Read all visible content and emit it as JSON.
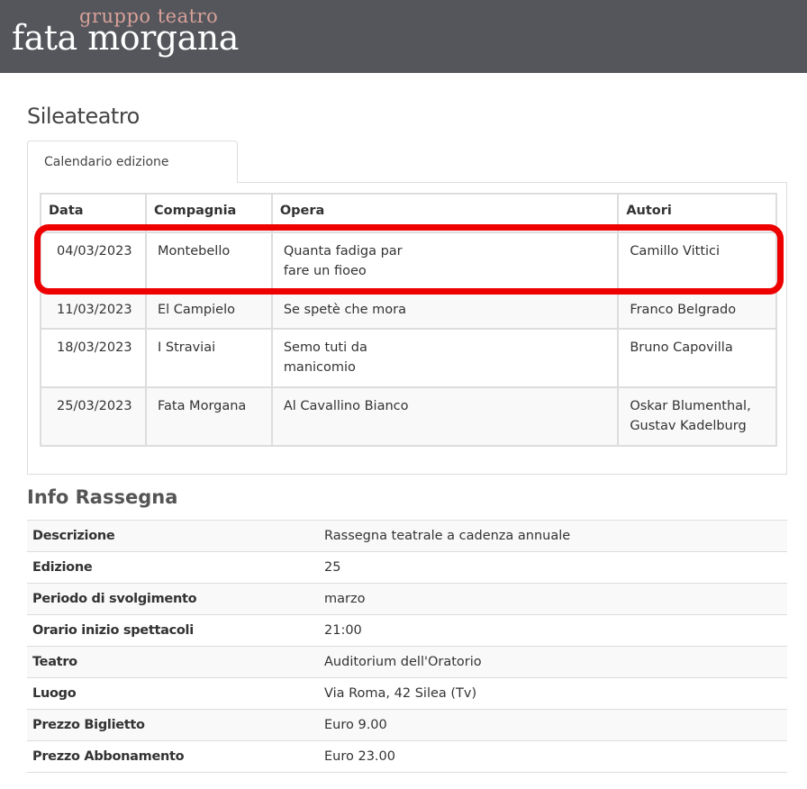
{
  "header": {
    "logo_top": "gruppo teatro",
    "logo_bottom": "fata morgana",
    "background_color": "#54565c",
    "logo_top_color": "#d8a199"
  },
  "page": {
    "title": "Sileateatro"
  },
  "tabs": [
    {
      "label": "Calendario edizione",
      "active": true
    }
  ],
  "calendar": {
    "columns": [
      "Data",
      "Compagnia",
      "Opera",
      "Autori"
    ],
    "rows": [
      {
        "data": "04/03/2023",
        "compagnia": "Montebello",
        "opera_l1": "Quanta fadiga par",
        "opera_l2": "fare un fioeo",
        "autori_l1": "Camillo Vittici",
        "autori_l2": ""
      },
      {
        "data": "11/03/2023",
        "compagnia": "El Campielo",
        "opera_l1": "Se spetè che mora",
        "opera_l2": "",
        "autori_l1": "Franco Belgrado",
        "autori_l2": ""
      },
      {
        "data": "18/03/2023",
        "compagnia": "I Straviai",
        "opera_l1": "Semo tuti da",
        "opera_l2": "manicomio",
        "autori_l1": "Bruno Capovilla",
        "autori_l2": ""
      },
      {
        "data": "25/03/2023",
        "compagnia": "Fata Morgana",
        "opera_l1": "Al Cavallino Bianco",
        "opera_l2": "",
        "autori_l1": "Oskar Blumenthal,",
        "autori_l2": "Gustav Kadelburg"
      }
    ],
    "highlight_color": "#ee0000"
  },
  "info": {
    "title": "Info Rassegna",
    "rows": [
      {
        "label": "Descrizione",
        "value": "Rassegna teatrale a cadenza annuale"
      },
      {
        "label": "Edizione",
        "value": "25"
      },
      {
        "label": "Periodo di svolgimento",
        "value": "marzo"
      },
      {
        "label": "Orario inizio spettacoli",
        "value": "21:00"
      },
      {
        "label": "Teatro",
        "value": "Auditorium dell'Oratorio"
      },
      {
        "label": "Luogo",
        "value": "Via Roma, 42 Silea (Tv)"
      },
      {
        "label": "Prezzo Biglietto",
        "value": "Euro 9.00"
      },
      {
        "label": "Prezzo Abbonamento",
        "value": "Euro 23.00"
      }
    ]
  }
}
